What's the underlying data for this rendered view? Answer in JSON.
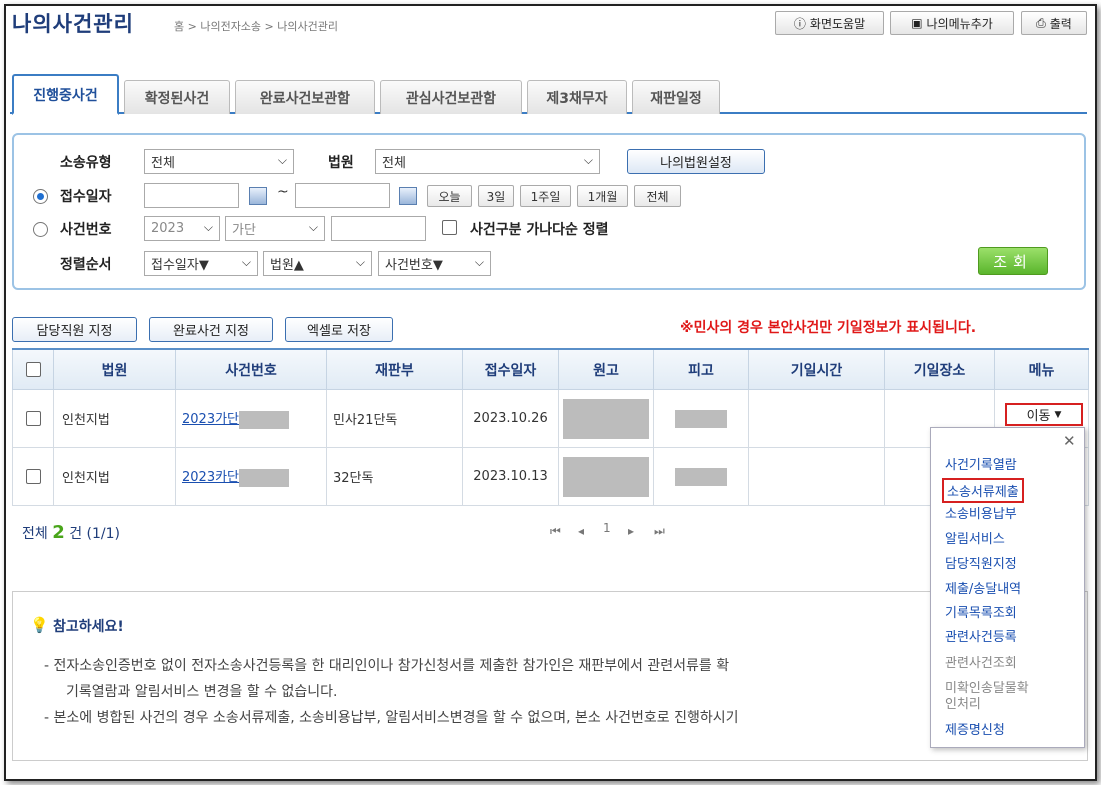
{
  "header": {
    "title": "나의사건관리",
    "breadcrumb": "홈 > 나의전자소송 > 나의사건관리",
    "help_label": "화면도움말",
    "add_menu_label": "나의메뉴추가",
    "print_label": "출력"
  },
  "tabs": [
    {
      "label": "진행중사건",
      "active": true
    },
    {
      "label": "확정된사건"
    },
    {
      "label": "완료사건보관함"
    },
    {
      "label": "관심사건보관함"
    },
    {
      "label": "제3채무자"
    },
    {
      "label": "재판일정"
    }
  ],
  "search": {
    "case_type_label": "소송유형",
    "case_type_value": "전체",
    "court_label": "법원",
    "court_value": "전체",
    "my_court_btn": "나의법원설정",
    "receipt_date_label": "접수일자",
    "date_sep": "~",
    "quick": [
      "오늘",
      "3일",
      "1주일",
      "1개월",
      "전체"
    ],
    "case_no_label": "사건번호",
    "year_value": "2023",
    "case_kind_value": "가단",
    "sort_checkbox_label": "사건구분 가나다순 정렬",
    "order_label": "정렬순서",
    "order1": "접수일자▼",
    "order2": "법원▲",
    "order3": "사건번호▼",
    "search_btn": "조회"
  },
  "actions": {
    "assign_staff": "담당직원 지정",
    "complete_case": "완료사건 지정",
    "excel": "엑셀로 저장",
    "notice": "※민사의 경우 본안사건만 기일정보가 표시됩니다."
  },
  "table": {
    "headers": [
      "법원",
      "사건번호",
      "재판부",
      "접수일자",
      "원고",
      "피고",
      "기일시간",
      "기일장소",
      "메뉴"
    ],
    "rows": [
      {
        "court": "인천지법",
        "case_no": "2023가단",
        "division": "민사21단독",
        "date": "2023.10.26",
        "menu": "이동"
      },
      {
        "court": "인천지법",
        "case_no": "2023카단",
        "division": "32단독",
        "date": "2023.10.13"
      }
    ]
  },
  "summary": {
    "total_prefix": "전체",
    "total_count": "2",
    "total_suffix": "건 (1/1)",
    "current_page": "1"
  },
  "info": {
    "title": "참고하세요!",
    "line1": "- 전자소송인증번호 없이 전자소송사건등록을 한 대리인이나 참가신청서를 제출한 참가인은 재판부에서 관련서류를 확",
    "line2": "기록열람과 알림서비스 변경을 할 수 없습니다.",
    "line3": "- 본소에 병합된 사건의 경우 소송서류제출, 소송비용납부, 알림서비스변경을 할 수 없으며, 본소 사건번호로 진행하시기"
  },
  "dropdown": {
    "items": [
      {
        "label": "사건기록열람"
      },
      {
        "label": "소송서류제출",
        "highlight": true
      },
      {
        "label": "소송비용납부"
      },
      {
        "label": "알림서비스"
      },
      {
        "label": "담당직원지정"
      },
      {
        "label": "제출/송달내역"
      },
      {
        "label": "기록목록조회"
      },
      {
        "label": "관련사건등록"
      },
      {
        "label": "관련사건조회",
        "disabled": true
      },
      {
        "label": "미확인송달물확",
        "disabled": true
      },
      {
        "label": "인처리",
        "disabled": true
      },
      {
        "label": "제증명신청"
      }
    ]
  }
}
